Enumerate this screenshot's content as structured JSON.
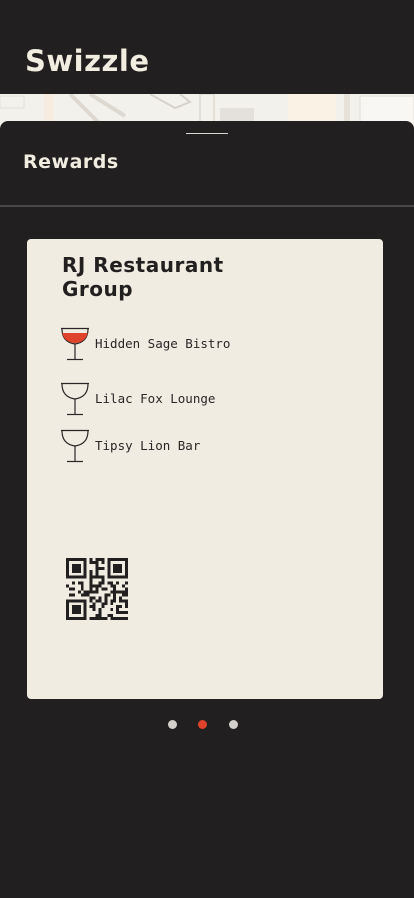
{
  "app": {
    "title": "Swizzle"
  },
  "sheet": {
    "title": "Rewards"
  },
  "rewards_card": {
    "group_name": "RJ Restaurant Group",
    "venues": [
      {
        "label": "Hidden Sage Bistro",
        "icon": "cocktail-glass-filled-icon",
        "active": true
      },
      {
        "label": "Lilac Fox Lounge",
        "icon": "cocktail-glass-icon",
        "active": false
      },
      {
        "label": "Tipsy Lion Bar",
        "icon": "cocktail-glass-icon",
        "active": false
      }
    ],
    "qr_icon": "qr-code-icon"
  },
  "pagination": {
    "count": 3,
    "active_index": 1
  },
  "colors": {
    "background": "#221f20",
    "card": "#f0ece1",
    "accent": "#e0432b",
    "text_light": "#f1ede0"
  }
}
